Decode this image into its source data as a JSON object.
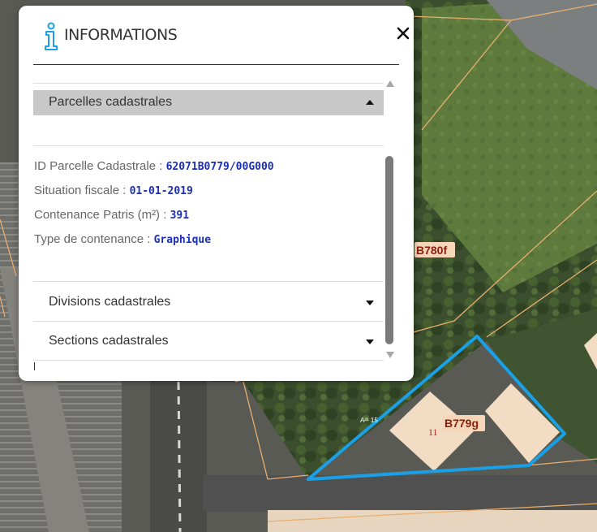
{
  "panel": {
    "title": "INFORMATIONS",
    "close_glyph": "✕",
    "info_icon": "info-icon"
  },
  "sections": {
    "parcelles": {
      "label": "Parcelles cadastrales",
      "expanded": true
    },
    "divisions": {
      "label": "Divisions cadastrales",
      "expanded": false
    },
    "sections_cad": {
      "label": "Sections cadastrales",
      "expanded": false
    }
  },
  "fields": {
    "id_parcelle": {
      "label": "ID Parcelle Cadastrale : ",
      "value": "62071B0779/00G000"
    },
    "situation": {
      "label": "Situation fiscale : ",
      "value": "01-01-2019"
    },
    "contenance": {
      "label": "Contenance Patris (m²) : ",
      "value": "391"
    },
    "type": {
      "label": "Type de contenance : ",
      "value": "Graphique"
    }
  },
  "map": {
    "labels": {
      "parcel_b780f": "B780f",
      "parcel_b779g": "B779g",
      "house_number": "11",
      "small_label": "A²¹ 15"
    },
    "colors": {
      "highlight": "#1aa0e6",
      "parcel_line": "#e8b070",
      "building": "#f2dcc4",
      "label_bg": "#f6d6b8"
    }
  }
}
